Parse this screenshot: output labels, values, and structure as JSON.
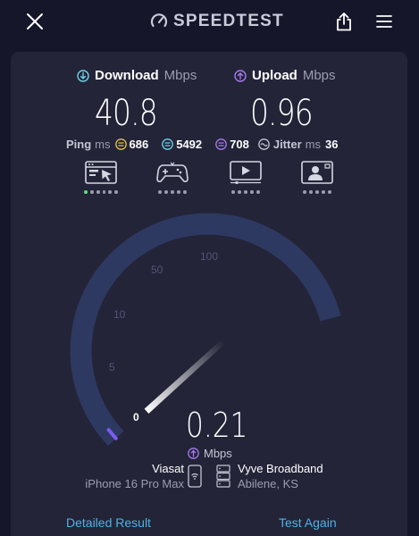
{
  "app": {
    "title": "SPEEDTEST"
  },
  "download": {
    "label": "Download",
    "unit": "Mbps",
    "value": "40.8"
  },
  "upload": {
    "label": "Upload",
    "unit": "Mbps",
    "value": "0.96"
  },
  "ping": {
    "label": "Ping",
    "unit": "ms",
    "idle": "686",
    "download": "5492",
    "upload": "708",
    "jitter_label": "Jitter",
    "jitter_unit": "ms",
    "jitter": "36"
  },
  "categories": [
    {
      "name": "browsing",
      "icon": "web-browsing-icon",
      "active_dots": 1,
      "total_dots": 6
    },
    {
      "name": "gaming",
      "icon": "game-controller-icon",
      "active_dots": 0,
      "total_dots": 5
    },
    {
      "name": "video",
      "icon": "video-streaming-icon",
      "active_dots": 0,
      "total_dots": 5
    },
    {
      "name": "video-chat",
      "icon": "video-chat-icon",
      "active_dots": 0,
      "total_dots": 5
    }
  ],
  "gauge": {
    "ticks": [
      "0",
      "5",
      "10",
      "50",
      "100"
    ],
    "current_value": 0.21,
    "needle_color": "#ffffff",
    "track_color": "#2e3961",
    "fill_color": "#7a5cf0"
  },
  "result": {
    "value": "0.21",
    "unit": "Mbps"
  },
  "client": {
    "isp": "Viasat",
    "device": "iPhone 16 Pro Max"
  },
  "server": {
    "name": "Vyve Broadband",
    "location": "Abilene, KS"
  },
  "footer": {
    "detailed": "Detailed Result",
    "again": "Test Again"
  },
  "colors": {
    "accent": "#4fb3e4",
    "download_icon": "#6fd3e8",
    "upload_icon": "#a77bf0",
    "ping_idle": "#e6c24a",
    "ping_down": "#6fd3e8",
    "ping_up": "#a77bf0"
  }
}
